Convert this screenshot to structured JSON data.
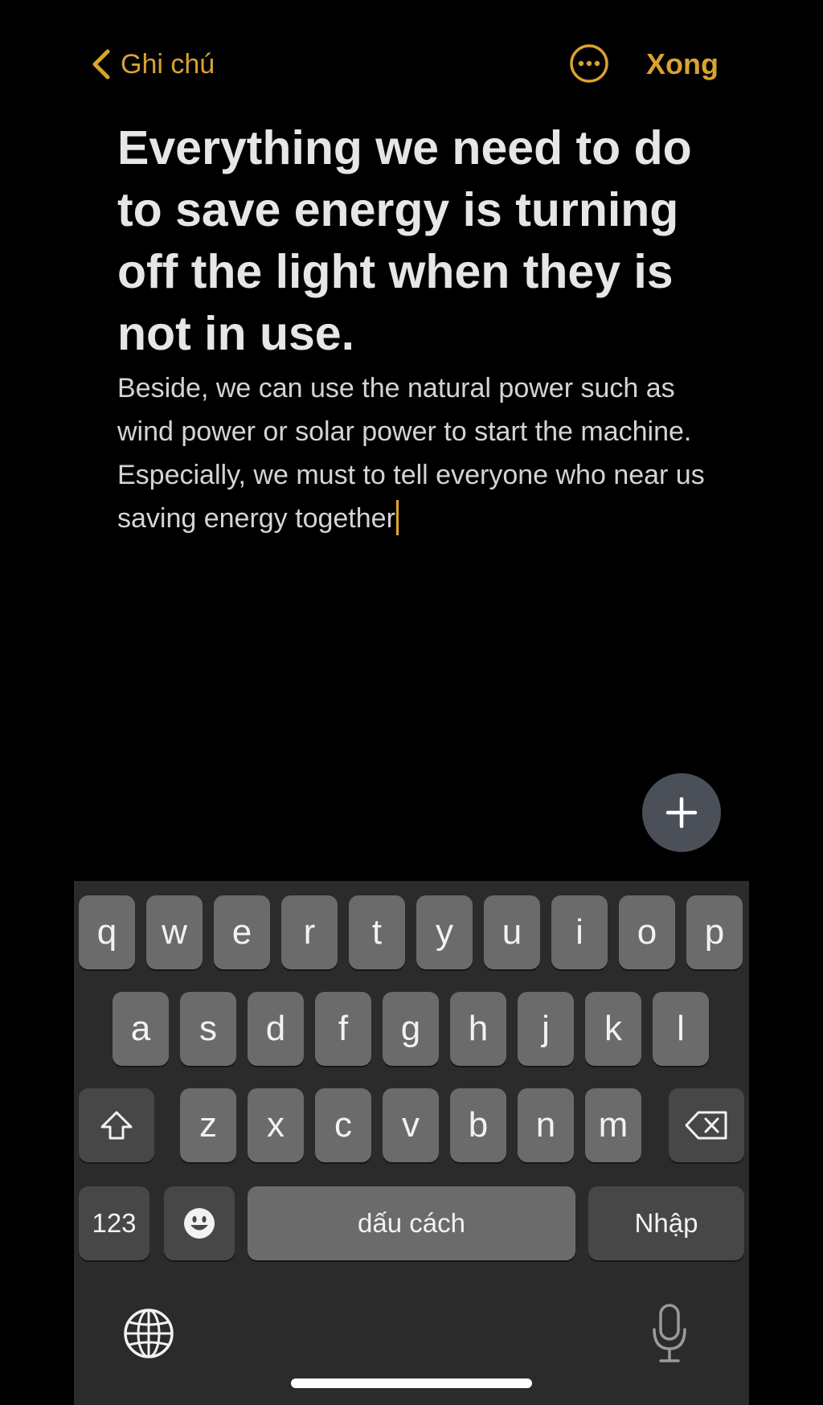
{
  "header": {
    "back_label": "Ghi chú",
    "done_label": "Xong"
  },
  "note": {
    "title": "Everything we need to do to save energy is turning off the light when they is not in use.",
    "body": "Beside, we can use the natural power such as wind power or solar power to start the machine. Especially, we must to tell everyone who near us saving energy together"
  },
  "keyboard": {
    "row1": [
      "q",
      "w",
      "e",
      "r",
      "t",
      "y",
      "u",
      "i",
      "o",
      "p"
    ],
    "row2": [
      "a",
      "s",
      "d",
      "f",
      "g",
      "h",
      "j",
      "k",
      "l"
    ],
    "row3": [
      "z",
      "x",
      "c",
      "v",
      "b",
      "n",
      "m"
    ],
    "numbers_label": "123",
    "space_label": "dấu cách",
    "return_label": "Nhập"
  },
  "colors": {
    "accent": "#d9a230",
    "background": "#000000",
    "keyboard_background": "#2b2b2b",
    "key": "#6b6b6b",
    "key_dark": "#474747",
    "add_button": "#4a4f58"
  },
  "icons": {
    "back": "chevron-left-icon",
    "more": "ellipsis-circle-icon",
    "add": "plus-icon",
    "shift": "shift-icon",
    "delete": "backspace-icon",
    "emoji": "emoji-icon",
    "globe": "globe-icon",
    "mic": "microphone-icon"
  }
}
